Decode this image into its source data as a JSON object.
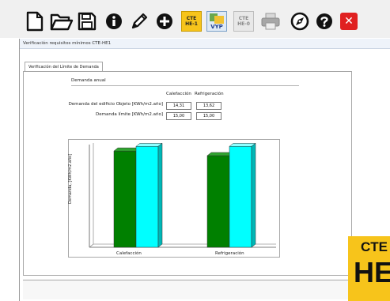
{
  "toolbar": {
    "buttons": [
      {
        "icon": "new-file-icon"
      },
      {
        "icon": "open-folder-icon"
      },
      {
        "icon": "save-icon"
      },
      {
        "icon": "info-icon"
      },
      {
        "icon": "pencil-icon"
      },
      {
        "icon": "add-icon"
      },
      {
        "icon": "cte-he1-icon",
        "label": "CTE\nHE-1"
      },
      {
        "icon": "vyp-icon",
        "label": "VYP"
      },
      {
        "icon": "cte-he0-icon",
        "label": "CTE\nHE-0"
      },
      {
        "icon": "printer-icon"
      },
      {
        "icon": "compass-icon"
      },
      {
        "icon": "help-icon"
      },
      {
        "icon": "close-icon"
      }
    ],
    "cte_he1_top": "CTE",
    "cte_he1_bottom": "HE-1",
    "vyp_label": "VYP",
    "cte_he0_top": "CTE",
    "cte_he0_bottom": "HE-0",
    "close_glyph": "✕"
  },
  "window": {
    "title": "Verificación requisitos mínimos CTE-HE1",
    "tab_label": "Verificación del Límite de Demanda"
  },
  "demand": {
    "section_title": "Demanda anual",
    "col_heating": "Calefacción",
    "col_cooling": "Refrigeración",
    "row1_label": "Demanda del edificio Objeto [KWh/m2.año]",
    "row1_heating": "14,31",
    "row1_cooling": "13,62",
    "row2_label": "Demanda límite [KWh/m2.año]",
    "row2_heating": "15,00",
    "row2_cooling": "15,00"
  },
  "chart_data": {
    "type": "bar",
    "categories": [
      "Calefacción",
      "Refrigeración"
    ],
    "series": [
      {
        "values": [
          14.31,
          13.62
        ],
        "color": "#008000"
      },
      {
        "values": [
          15.0,
          15.0
        ],
        "color": "#00ffff"
      }
    ],
    "ylabel": "Demanda, [KWh/m2.año]",
    "ylim": [
      0,
      15.5
    ]
  },
  "logo": {
    "top": "CTE",
    "bottom": "HE"
  }
}
